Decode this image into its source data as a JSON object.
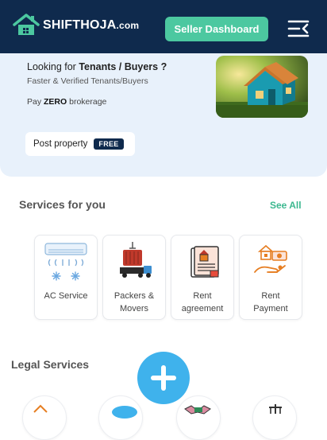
{
  "header": {
    "logo_text": "SHIFTHOJA",
    "logo_domain": ".com",
    "seller_button": "Seller Dashboard",
    "menu_icon": "menu-collapse-icon",
    "bg_color": "#0f2a4d",
    "accent_color": "#4cc8a0"
  },
  "hero": {
    "title_prefix": "Looking for ",
    "title_bold": "Tenants / Buyers ?",
    "subtitle": "Faster & Verified Tenants/Buyers",
    "pay_prefix": "Pay ",
    "pay_bold": "ZERO",
    "pay_suffix": " brokerage",
    "post_button": "Post property",
    "free_badge": "FREE",
    "image": "house-photo"
  },
  "services": {
    "title": "Services for you",
    "see_all": "See All",
    "items": [
      {
        "label_line1": "AC Service",
        "label_line2": "",
        "icon": "ac-service-icon"
      },
      {
        "label_line1": "Packers &",
        "label_line2": "Movers",
        "icon": "truck-icon"
      },
      {
        "label_line1": "Rent",
        "label_line2": "agreement",
        "icon": "agreement-icon"
      },
      {
        "label_line1": "Rent",
        "label_line2": "Payment",
        "icon": "rent-payment-icon"
      }
    ]
  },
  "legal": {
    "title": "Legal Services"
  },
  "fab": {
    "icon": "plus-icon",
    "color": "#3fb2ec"
  }
}
